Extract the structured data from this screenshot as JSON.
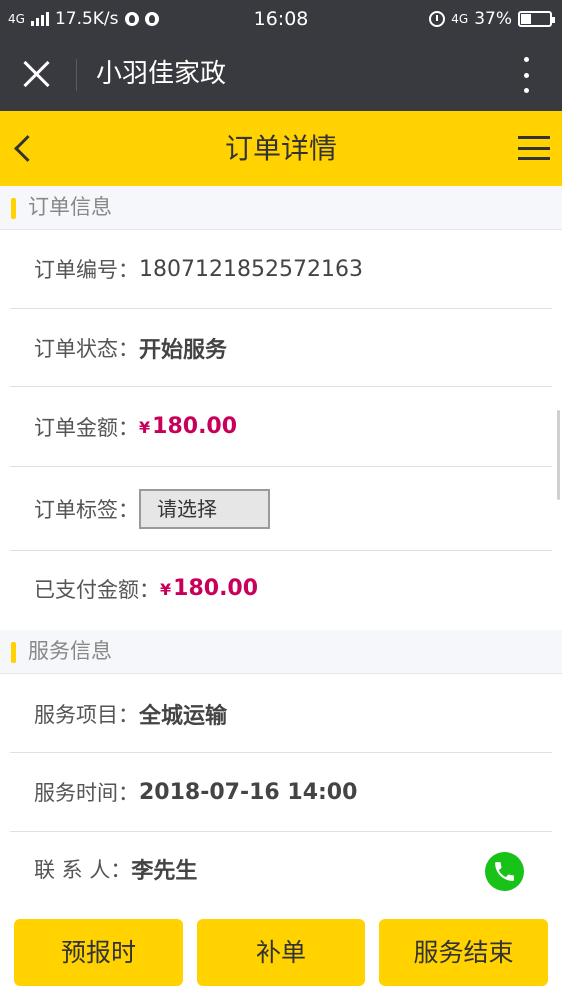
{
  "status_bar": {
    "network": "4G",
    "speed": "17.5K/s",
    "time": "16:08",
    "network_right": "4G",
    "battery": "37%",
    "battery_level": 0.37
  },
  "wechat_bar": {
    "title": "小羽佳家政"
  },
  "header": {
    "title": "订单详情"
  },
  "order_section": {
    "title": "订单信息",
    "order_no_label": "订单编号：",
    "order_no": "1807121852572163",
    "status_label": "订单状态：",
    "status": "开始服务",
    "amount_label": "订单金额：",
    "amount_currency": "¥",
    "amount": "180.00",
    "tag_label": "订单标签：",
    "tag_select": "请选择",
    "paid_label": "已支付金额：",
    "paid_currency": "¥",
    "paid": "180.00"
  },
  "service_section": {
    "title": "服务信息",
    "item_label": "服务项目：",
    "item": "全城运输",
    "time_label": "服务时间：",
    "time": "2018-07-16 14:00",
    "contact_label": "联 系 人：",
    "contact": "李先生"
  },
  "footer": {
    "btn_report": "预报时",
    "btn_supplement": "补单",
    "btn_finish": "服务结束"
  },
  "colors": {
    "accent": "#ffd200",
    "money": "#c8005a",
    "phone": "#19c219",
    "topbar": "#393a3f"
  }
}
